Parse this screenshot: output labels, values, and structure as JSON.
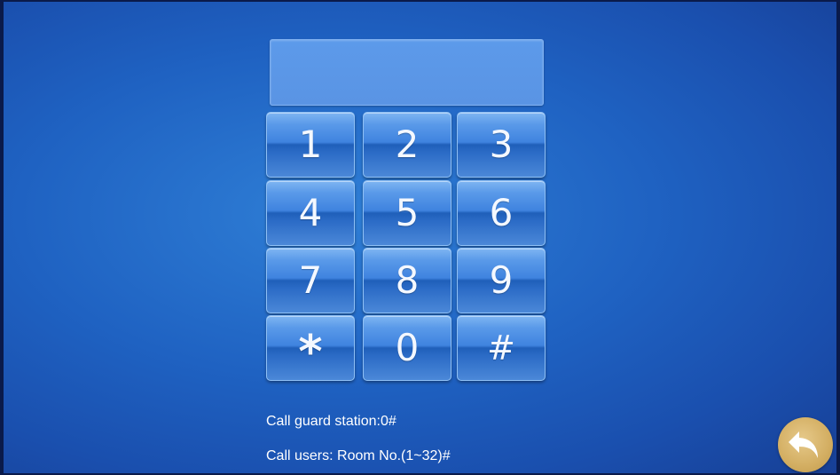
{
  "display": {
    "value": ""
  },
  "keypad": {
    "keys": [
      {
        "label": "1"
      },
      {
        "label": "2"
      },
      {
        "label": "3"
      },
      {
        "label": "4"
      },
      {
        "label": "5"
      },
      {
        "label": "6"
      },
      {
        "label": "7"
      },
      {
        "label": "8"
      },
      {
        "label": "9"
      },
      {
        "label": "*"
      },
      {
        "label": "0"
      },
      {
        "label": "#"
      }
    ]
  },
  "info": {
    "guard_station": "Call guard station:0#",
    "users": "Call users: Room No.(1~32)#"
  },
  "back_button": {
    "icon": "back-arrow-icon",
    "color": "#d3ae62"
  },
  "colors": {
    "background": "#1f62c2",
    "key": "#3f83df",
    "display": "#5c9aea"
  }
}
